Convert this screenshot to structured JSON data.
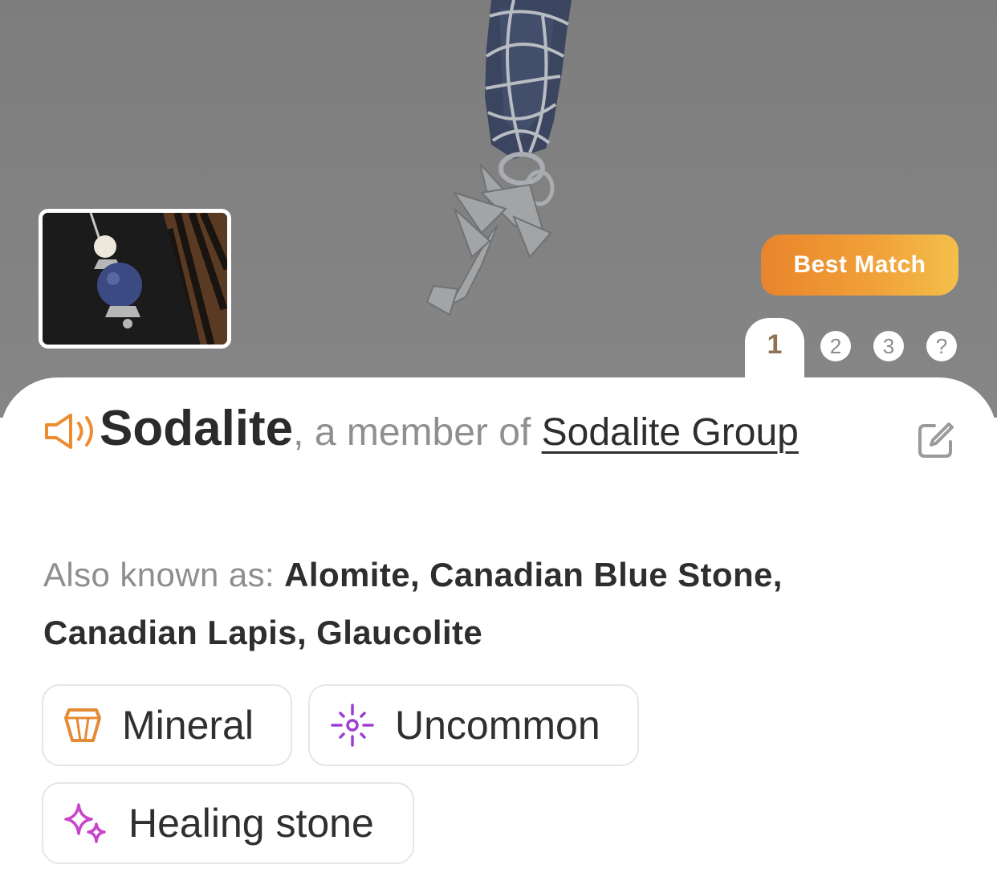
{
  "header": {
    "badge": "Best Match",
    "tabs": [
      "1",
      "2",
      "3",
      "?"
    ],
    "active_tab": "1"
  },
  "result": {
    "name": "Sodalite",
    "member_prefix": ", a member of ",
    "group": "Sodalite Group",
    "aka_label": "Also known as: ",
    "aka_values": "Alomite, Canadian Blue Stone, Canadian Lapis, Glaucolite"
  },
  "tags": [
    {
      "label": "Mineral",
      "icon": "crystal-icon",
      "color": "#e68a35"
    },
    {
      "label": "Uncommon",
      "icon": "sparkle-burst-icon",
      "color": "#9d3fd3"
    },
    {
      "label": "Healing stone",
      "icon": "sparkles-icon",
      "color": "#c845c9"
    }
  ],
  "colors": {
    "accent_orange": "#ee8c2f",
    "tab_active_text": "#8f7155",
    "muted_text": "#8f8f8f"
  }
}
